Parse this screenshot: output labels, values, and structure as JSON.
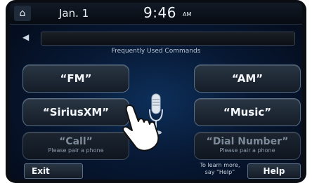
{
  "status": {
    "date": "Jan.  1",
    "time": "9:46",
    "ampm": "AM"
  },
  "header": {
    "title": "Frequently Used Commands"
  },
  "buttons": {
    "fm": "“FM”",
    "am": "“AM”",
    "sirius": "“SiriusXM”",
    "music": "“Music”",
    "call": {
      "label": "“Call”",
      "sub": "Please pair a phone"
    },
    "dial": {
      "label": "“Dial Number”",
      "sub": "Please pair a phone"
    }
  },
  "footer": {
    "exit": "Exit",
    "help": "Help",
    "hint_line1": "To learn more,",
    "hint_line2": "say “Help”"
  },
  "icons": [
    "home-icon",
    "speaker-icon",
    "microphone-icon",
    "pointing-hand-icon"
  ]
}
